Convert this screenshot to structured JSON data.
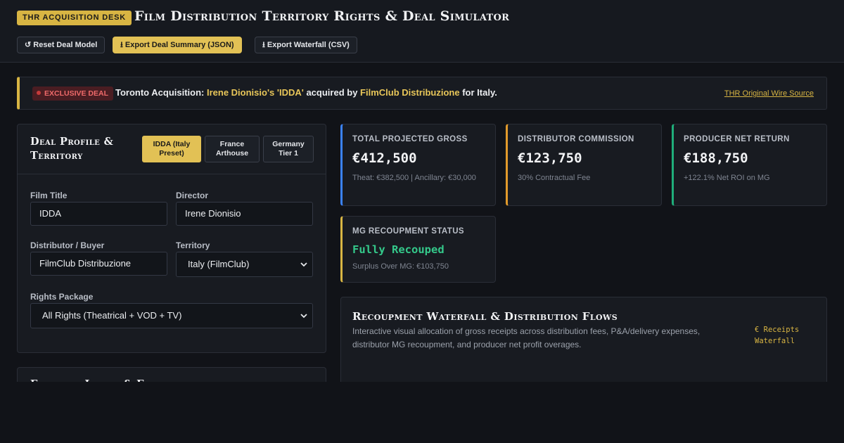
{
  "header": {
    "desk_badge": "THR ACQUISITION DESK",
    "title": "Film Distribution Territory Rights & Deal Simulator",
    "buttons": {
      "reset": "↺ Reset Deal Model",
      "export_json": "⭳ Export Deal Summary (JSON)",
      "export_csv": "⭳ Export Waterfall (CSV)"
    }
  },
  "alert": {
    "badge": "EXCLUSIVE DEAL",
    "prefix": "Toronto Acquisition: ",
    "film_highlight": "Irene Dionisio's 'IDDA'",
    "middle": " acquired by ",
    "buyer_highlight": "FilmClub Distribuzione",
    "suffix": " for Italy.",
    "link": "THR Original Wire Source"
  },
  "deal_profile": {
    "title": "Deal Profile & Territory",
    "presets": [
      {
        "label": "IDDA (Italy Preset)",
        "active": true
      },
      {
        "label": "France Arthouse",
        "active": false
      },
      {
        "label": "Germany Tier 1",
        "active": false
      }
    ],
    "fields": {
      "film_title": {
        "label": "Film Title",
        "value": "IDDA"
      },
      "director": {
        "label": "Director",
        "value": "Irene Dionisio"
      },
      "distributor": {
        "label": "Distributor / Buyer",
        "value": "FilmClub Distribuzione"
      },
      "territory": {
        "label": "Territory",
        "value": "Italy (FilmClub)"
      },
      "rights": {
        "label": "Rights Package",
        "value": "All Rights (Theatrical + VOD + TV)"
      }
    }
  },
  "next_panel": {
    "title": "Financial Inputs & Fees"
  },
  "metrics": {
    "gross": {
      "label": "TOTAL PROJECTED GROSS",
      "value": "€412,500",
      "sub": "Theat: €382,500 | Ancillary: €30,000"
    },
    "commission": {
      "label": "DISTRIBUTOR COMMISSION",
      "value": "€123,750",
      "sub": "30% Contractual Fee"
    },
    "net": {
      "label": "PRODUCER NET RETURN",
      "value": "€188,750",
      "sub": "+122.1% Net ROI on MG"
    },
    "mg": {
      "label": "MG RECOUPMENT STATUS",
      "value": "Fully Recouped",
      "sub": "Surplus Over MG: €103,750"
    }
  },
  "waterfall": {
    "title": "Recoupment Waterfall & Distribution Flows",
    "description": "Interactive visual allocation of gross receipts across distribution fees, P&A/delivery expenses, distributor MG recoupment, and producer net profit overages.",
    "tag": "€ Receipts Waterfall"
  },
  "colors": {
    "accent_gold": "#d8b543",
    "blue": "#3b82f6",
    "orange": "#e29a2b",
    "green": "#1fae7a",
    "danger": "#ef6a6a"
  }
}
